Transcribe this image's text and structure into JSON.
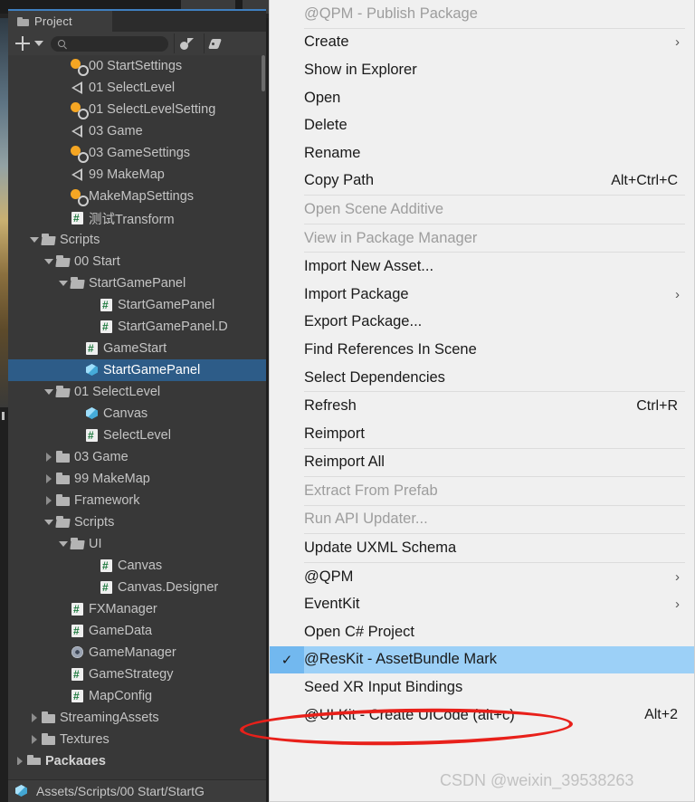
{
  "window": {
    "panel_tab": "Project",
    "search_placeholder": "",
    "search_value": "",
    "accent_blue": "#3f7fbf",
    "selection_blue": "#2d5c88",
    "menu_highlight": "#9cd0f7",
    "annotation_color": "#e8201a"
  },
  "toolbar": {
    "add_label": "+",
    "icons": [
      "avatar-icon",
      "tag-icon"
    ]
  },
  "tree": [
    {
      "label": "00 StartSettings",
      "icon": "bulb",
      "indent": 3,
      "twisty": "none"
    },
    {
      "label": "01 SelectLevel",
      "icon": "unity",
      "indent": 3,
      "twisty": "none"
    },
    {
      "label": "01 SelectLevelSetting",
      "icon": "bulb",
      "indent": 3,
      "twisty": "none"
    },
    {
      "label": "03 Game",
      "icon": "unity",
      "indent": 3,
      "twisty": "none"
    },
    {
      "label": "03 GameSettings",
      "icon": "bulb",
      "indent": 3,
      "twisty": "none"
    },
    {
      "label": "99 MakeMap",
      "icon": "unity",
      "indent": 3,
      "twisty": "none"
    },
    {
      "label": "MakeMapSettings",
      "icon": "bulb",
      "indent": 3,
      "twisty": "none"
    },
    {
      "label": "测试Transform",
      "icon": "cs",
      "indent": 3,
      "twisty": "none"
    },
    {
      "label": "Scripts",
      "icon": "folderopen",
      "indent": 1,
      "twisty": "open"
    },
    {
      "label": "00 Start",
      "icon": "folderopen",
      "indent": 2,
      "twisty": "open"
    },
    {
      "label": "StartGamePanel",
      "icon": "folderopen",
      "indent": 3,
      "twisty": "open"
    },
    {
      "label": "StartGamePanel",
      "icon": "cs",
      "indent": 5,
      "twisty": "none"
    },
    {
      "label": "StartGamePanel.D",
      "icon": "cs",
      "indent": 5,
      "twisty": "none"
    },
    {
      "label": "GameStart",
      "icon": "cs",
      "indent": 4,
      "twisty": "none"
    },
    {
      "label": "StartGamePanel",
      "icon": "prefab",
      "indent": 4,
      "twisty": "none",
      "selected": true
    },
    {
      "label": "01 SelectLevel",
      "icon": "folderopen",
      "indent": 2,
      "twisty": "open"
    },
    {
      "label": "Canvas",
      "icon": "prefab",
      "indent": 4,
      "twisty": "none"
    },
    {
      "label": "SelectLevel",
      "icon": "cs",
      "indent": 4,
      "twisty": "none"
    },
    {
      "label": "03 Game",
      "icon": "folder",
      "indent": 2,
      "twisty": "closed"
    },
    {
      "label": "99 MakeMap",
      "icon": "folder",
      "indent": 2,
      "twisty": "closed"
    },
    {
      "label": "Framework",
      "icon": "folder",
      "indent": 2,
      "twisty": "closed"
    },
    {
      "label": "Scripts",
      "icon": "folderopen",
      "indent": 2,
      "twisty": "open"
    },
    {
      "label": "UI",
      "icon": "folderopen",
      "indent": 3,
      "twisty": "open"
    },
    {
      "label": "Canvas",
      "icon": "cs",
      "indent": 5,
      "twisty": "none"
    },
    {
      "label": "Canvas.Designer",
      "icon": "cs",
      "indent": 5,
      "twisty": "none"
    },
    {
      "label": "FXManager",
      "icon": "cs",
      "indent": 3,
      "twisty": "none"
    },
    {
      "label": "GameData",
      "icon": "cs",
      "indent": 3,
      "twisty": "none"
    },
    {
      "label": "GameManager",
      "icon": "gear",
      "indent": 3,
      "twisty": "none"
    },
    {
      "label": "GameStrategy",
      "icon": "cs",
      "indent": 3,
      "twisty": "none"
    },
    {
      "label": "MapConfig",
      "icon": "cs",
      "indent": 3,
      "twisty": "none"
    },
    {
      "label": "StreamingAssets",
      "icon": "folder",
      "indent": 1,
      "twisty": "closed"
    },
    {
      "label": "Textures",
      "icon": "folder",
      "indent": 1,
      "twisty": "closed"
    },
    {
      "label": "Packages",
      "icon": "folder",
      "indent": 0,
      "twisty": "closed",
      "bold": true
    }
  ],
  "status_bar": {
    "icon": "prefab-icon",
    "path": "Assets/Scripts/00 Start/StartG"
  },
  "context_menu": [
    {
      "label": "@QPM - Publish Package",
      "state": "disabled"
    },
    {
      "separator": true
    },
    {
      "label": "Create",
      "submenu": true
    },
    {
      "label": "Show in Explorer"
    },
    {
      "label": "Open"
    },
    {
      "label": "Delete"
    },
    {
      "label": "Rename"
    },
    {
      "label": "Copy Path",
      "shortcut": "Alt+Ctrl+C"
    },
    {
      "separator": true
    },
    {
      "label": "Open Scene Additive",
      "state": "disabled"
    },
    {
      "separator": true
    },
    {
      "label": "View in Package Manager",
      "state": "disabled"
    },
    {
      "separator": true
    },
    {
      "label": "Import New Asset..."
    },
    {
      "label": "Import Package",
      "submenu": true
    },
    {
      "label": "Export Package..."
    },
    {
      "label": "Find References In Scene"
    },
    {
      "label": "Select Dependencies"
    },
    {
      "separator": true
    },
    {
      "label": "Refresh",
      "shortcut": "Ctrl+R"
    },
    {
      "label": "Reimport"
    },
    {
      "separator": true
    },
    {
      "label": "Reimport All"
    },
    {
      "separator": true
    },
    {
      "label": "Extract From Prefab",
      "state": "disabled"
    },
    {
      "separator": true
    },
    {
      "label": "Run API Updater...",
      "state": "disabled"
    },
    {
      "separator": true
    },
    {
      "label": "Update UXML Schema"
    },
    {
      "separator": true
    },
    {
      "label": "@QPM",
      "submenu": true
    },
    {
      "label": "EventKit",
      "submenu": true
    },
    {
      "label": "Open C# Project"
    },
    {
      "label": "@ResKit - AssetBundle Mark",
      "checked": true,
      "highlighted": true
    },
    {
      "label": "Seed XR Input Bindings"
    },
    {
      "label": "@UI Kit - Create UICode (alt+c)",
      "shortcut": "Alt+2"
    }
  ],
  "watermark": "CSDN @weixin_39538263"
}
